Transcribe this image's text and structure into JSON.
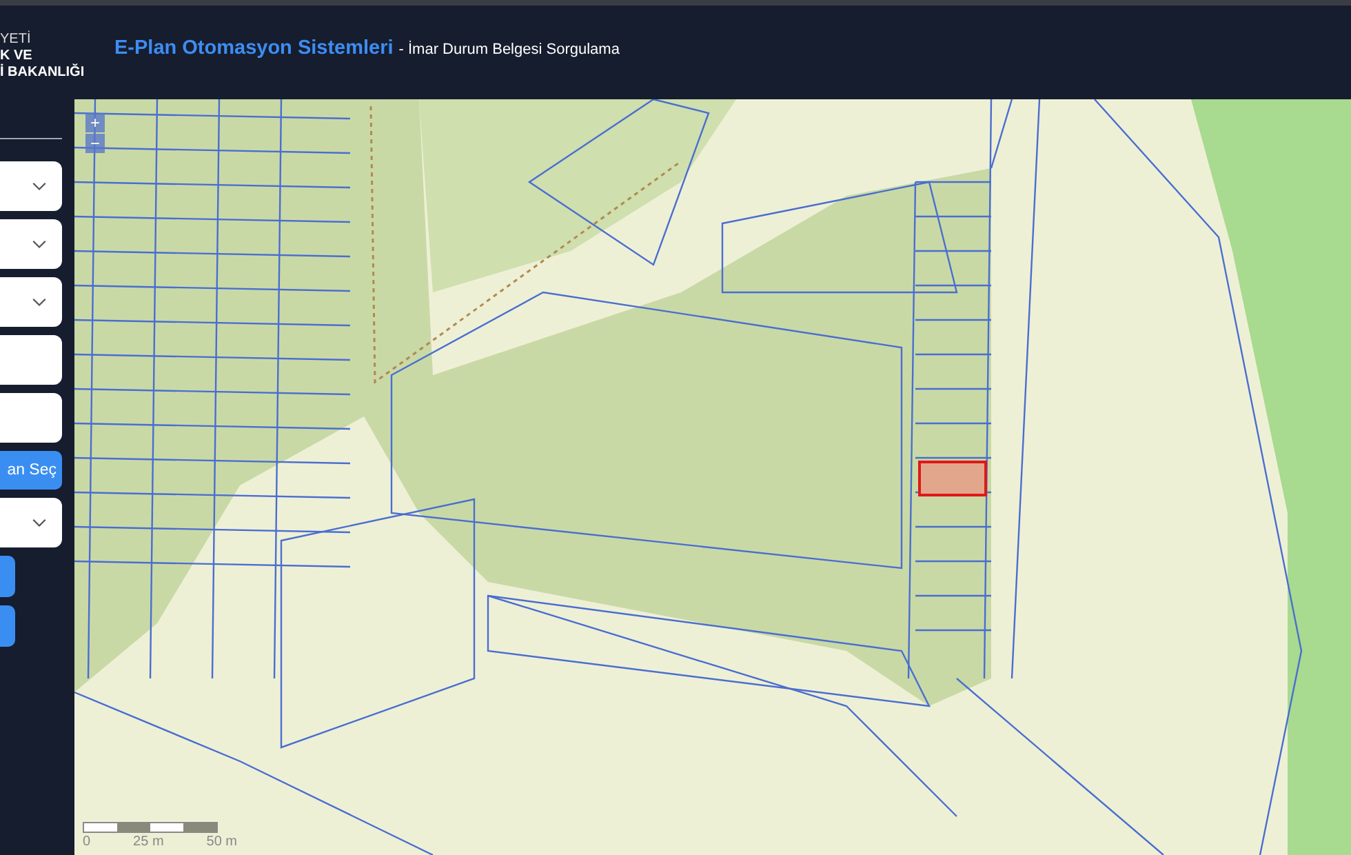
{
  "logo": {
    "lines": [
      "YETİ",
      "K VE",
      "İ BAKANLIĞI"
    ]
  },
  "header": {
    "title": "E-Plan Otomasyon Sistemleri",
    "subtitle": "- İmar Durum Belgesi Sorgulama"
  },
  "sidebar": {
    "controls": [
      {
        "kind": "select"
      },
      {
        "kind": "select"
      },
      {
        "kind": "select"
      },
      {
        "kind": "input"
      },
      {
        "kind": "input"
      },
      {
        "kind": "button",
        "label": "an Seç"
      },
      {
        "kind": "select"
      },
      {
        "kind": "button"
      },
      {
        "kind": "button"
      }
    ]
  },
  "map": {
    "zoom_controls": [
      "+",
      "−"
    ],
    "scale_labels": [
      "0",
      "25 m",
      "50 m"
    ]
  }
}
